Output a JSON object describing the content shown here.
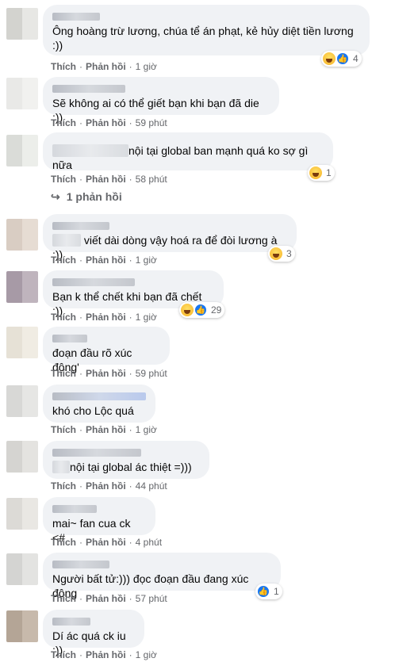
{
  "action_like": "Thích",
  "action_reply": "Phản hồi",
  "comments": [
    {
      "text": "Ông hoàng trừ lương, chúa tể án phạt, kẻ hủy diệt tiền lương\n:))",
      "time": "1 giờ",
      "reactions": "4"
    },
    {
      "text": "Sẽ không ai có thể giết bạn khi bạn đã die :))",
      "time": "59 phút"
    },
    {
      "text": "nội tại global ban mạnh quá ko sợ gì nữa",
      "time": "58 phút",
      "reactions": "1",
      "replies": "1 phản hồi"
    },
    {
      "text": "viết dài dòng vậy hoá ra để đòi lương à :))",
      "time": "1 giờ",
      "reactions": "3"
    },
    {
      "text": "Bạn k thể chết khi bạn đã chết :))",
      "time": "1 giờ",
      "reactions": "29"
    },
    {
      "text": "đoạn đầu rõ xúc động'",
      "time": "59 phút"
    },
    {
      "text": "khó cho Lộc quá",
      "time": "1 giờ"
    },
    {
      "text": "nội tại global ác thiệt =)))",
      "time": "44 phút"
    },
    {
      "text": "mai~ fan cua ck <#",
      "time": "4 phút"
    },
    {
      "text": "Người bất tử:))) đọc đoạn đầu đang xúc động",
      "time": "57 phút",
      "reactions": "1"
    },
    {
      "text": "Dí ác quá ck iu :))",
      "time": "1 giờ"
    }
  ]
}
